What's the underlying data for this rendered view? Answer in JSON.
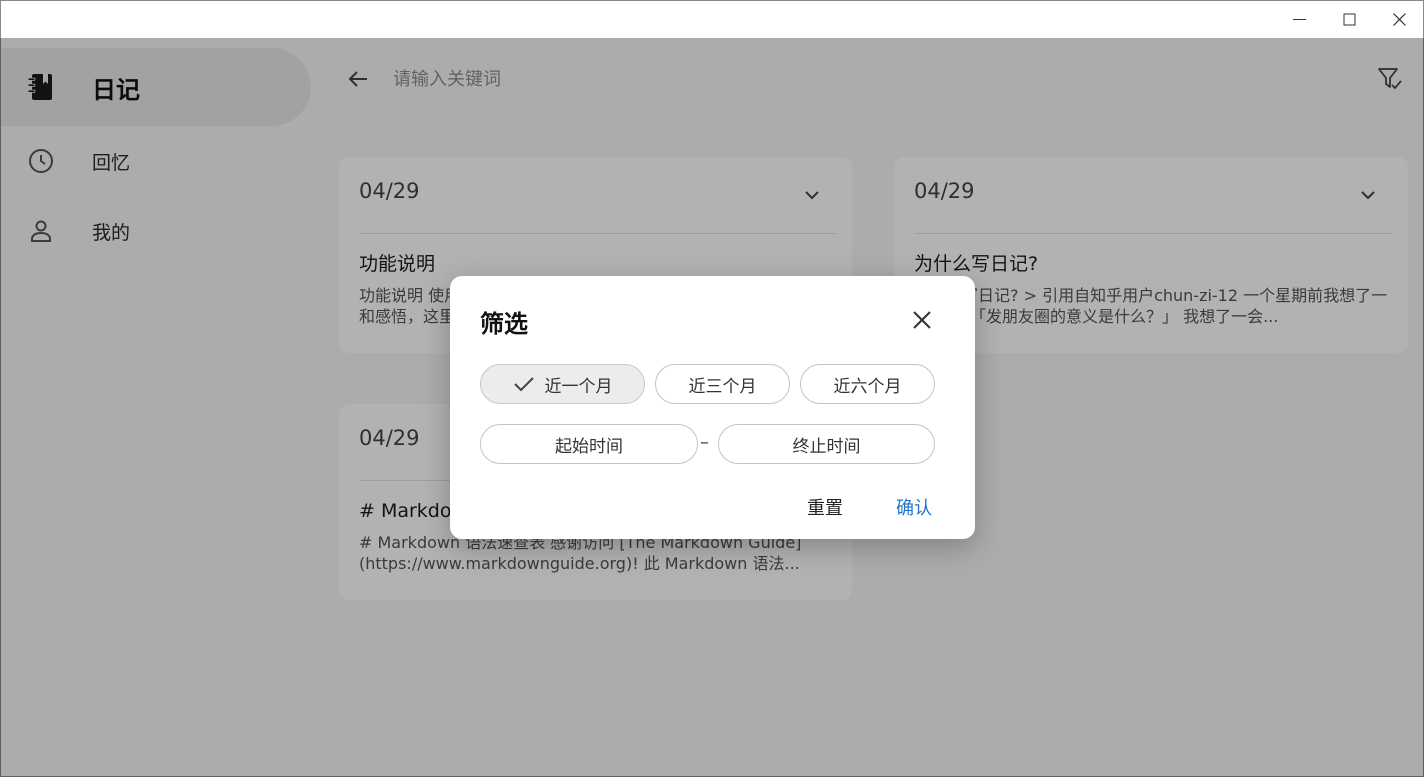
{
  "sidebar": {
    "items": [
      {
        "label": "日记",
        "icon": "notebook-icon",
        "active": true
      },
      {
        "label": "回忆",
        "icon": "clock-icon",
        "active": false
      },
      {
        "label": "我的",
        "icon": "person-icon",
        "active": false
      }
    ]
  },
  "header": {
    "search_placeholder": "请输入关键词",
    "back_icon": "arrow-left-icon",
    "filter_icon": "filter-check-icon"
  },
  "cards": [
    {
      "date": "04/29",
      "title": "功能说明",
      "body": "功能说明 使用日记可以记录生活中的点点滴滴，记录每一天的心情和感悟，这里是一个人的心底话，写下属于你的故事…"
    },
    {
      "date": "04/29",
      "title": "为什么写日记?",
      "body": "为什么写日记?  > 引用自知乎用户chun-zi-12 一个星期前我想了一个问题：「发朋友圈的意义是什么？」 我想了一会..."
    },
    {
      "date": "04/29",
      "title": "# Markdown 语法速查表",
      "body": "# Markdown 语法速查表 感谢访问 [The Markdown Guide](https://www.markdownguide.org)! 此 Markdown 语法..."
    }
  ],
  "filter_dialog": {
    "title": "筛选",
    "ranges": [
      {
        "label": "近一个月",
        "selected": true
      },
      {
        "label": "近三个月",
        "selected": false
      },
      {
        "label": "近六个月",
        "selected": false
      }
    ],
    "start_placeholder": "起始时间",
    "separator": "–",
    "end_placeholder": "终止时间",
    "reset_label": "重置",
    "confirm_label": "确认"
  },
  "colors": {
    "accent": "#1e74c9",
    "background": "#f7f7f7",
    "card": "#ffffff",
    "overlay": "rgba(0,0,0,0.30)"
  }
}
